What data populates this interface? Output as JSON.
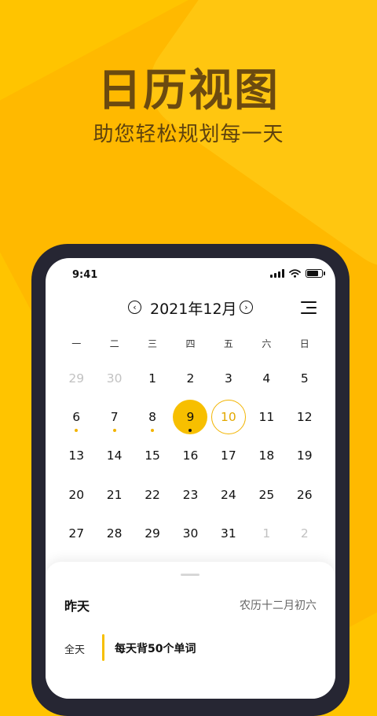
{
  "headline": "日历视图",
  "subline": "助您轻松规划每一天",
  "status": {
    "time": "9:41"
  },
  "calendar": {
    "month": "2021年12月",
    "prev_icon": "chevron-left-icon",
    "next_icon": "chevron-right-icon",
    "menu_icon": "menu-icon",
    "weekdays": [
      "一",
      "二",
      "三",
      "四",
      "五",
      "六",
      "日"
    ],
    "days": [
      {
        "n": "29",
        "muted": true
      },
      {
        "n": "30",
        "muted": true
      },
      {
        "n": "1"
      },
      {
        "n": "2"
      },
      {
        "n": "3"
      },
      {
        "n": "4"
      },
      {
        "n": "5"
      },
      {
        "n": "6",
        "dot": true
      },
      {
        "n": "7",
        "dot": true
      },
      {
        "n": "8",
        "dot": true
      },
      {
        "n": "9",
        "dot": true,
        "selected": true
      },
      {
        "n": "10",
        "today": true
      },
      {
        "n": "11"
      },
      {
        "n": "12"
      },
      {
        "n": "13"
      },
      {
        "n": "14"
      },
      {
        "n": "15"
      },
      {
        "n": "16"
      },
      {
        "n": "17"
      },
      {
        "n": "18"
      },
      {
        "n": "19"
      },
      {
        "n": "20"
      },
      {
        "n": "21"
      },
      {
        "n": "22"
      },
      {
        "n": "23"
      },
      {
        "n": "24"
      },
      {
        "n": "25"
      },
      {
        "n": "26"
      },
      {
        "n": "27"
      },
      {
        "n": "28"
      },
      {
        "n": "29"
      },
      {
        "n": "30"
      },
      {
        "n": "31"
      },
      {
        "n": "1",
        "muted": true
      },
      {
        "n": "2",
        "muted": true
      }
    ]
  },
  "sheet": {
    "day_title": "昨天",
    "lunar": "农历十二月初六",
    "event": {
      "time": "全天",
      "title": "每天背50个单词"
    }
  },
  "colors": {
    "accent": "#f7bf00",
    "background": "#ffc400",
    "phone": "#262633"
  }
}
